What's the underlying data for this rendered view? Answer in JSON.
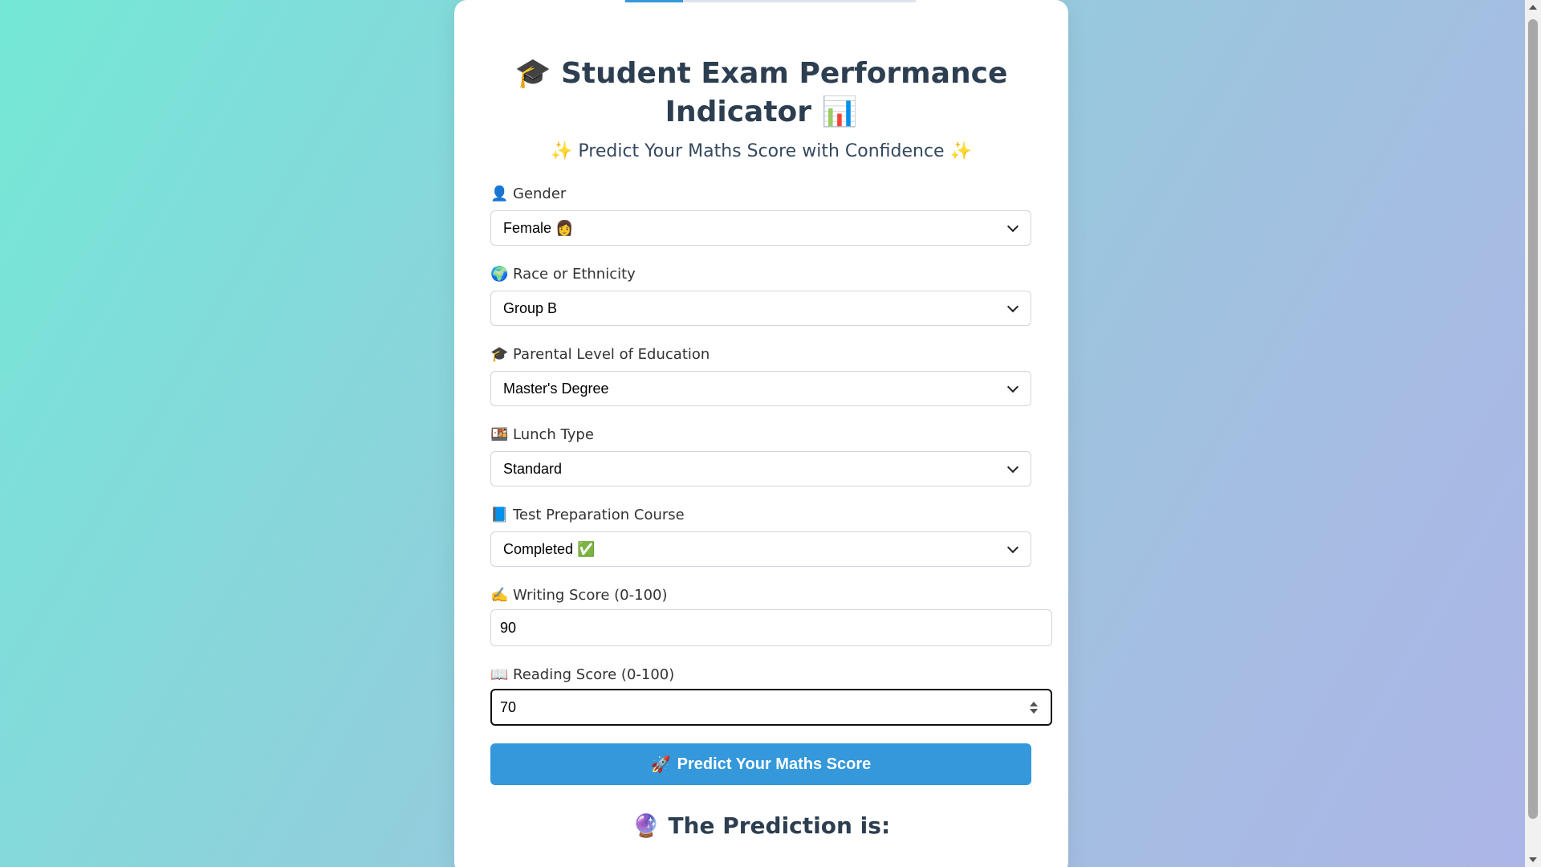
{
  "header": {
    "title_icon_left": "🎓",
    "title": "Student Exam Performance Indicator",
    "title_icon_right": "📊",
    "subtitle_icon_left": "✨",
    "subtitle": "Predict Your Maths Score with Confidence",
    "subtitle_icon_right": "✨"
  },
  "form": {
    "gender": {
      "icon": "👤",
      "label": "Gender",
      "value": "Female 👩"
    },
    "race": {
      "icon": "🌍",
      "label": "Race or Ethnicity",
      "value": "Group B"
    },
    "parental_education": {
      "icon": "🎓",
      "label": "Parental Level of Education",
      "value": "Master's Degree"
    },
    "lunch": {
      "icon": "🍱",
      "label": "Lunch Type",
      "value": "Standard"
    },
    "test_prep": {
      "icon": "📘",
      "label": "Test Preparation Course",
      "value": "Completed ✅"
    },
    "writing_score": {
      "icon": "✍️",
      "label": "Writing Score (0-100)",
      "value": "90"
    },
    "reading_score": {
      "icon": "📖",
      "label": "Reading Score (0-100)",
      "value": "70"
    }
  },
  "submit": {
    "icon": "🚀",
    "label": "Predict Your Maths Score"
  },
  "result": {
    "icon": "🔮",
    "heading": "The Prediction is:"
  },
  "colors": {
    "accent": "#3498db",
    "heading": "#2c3e50",
    "background_start": "#74e8d6",
    "background_end": "#adb5e8"
  }
}
